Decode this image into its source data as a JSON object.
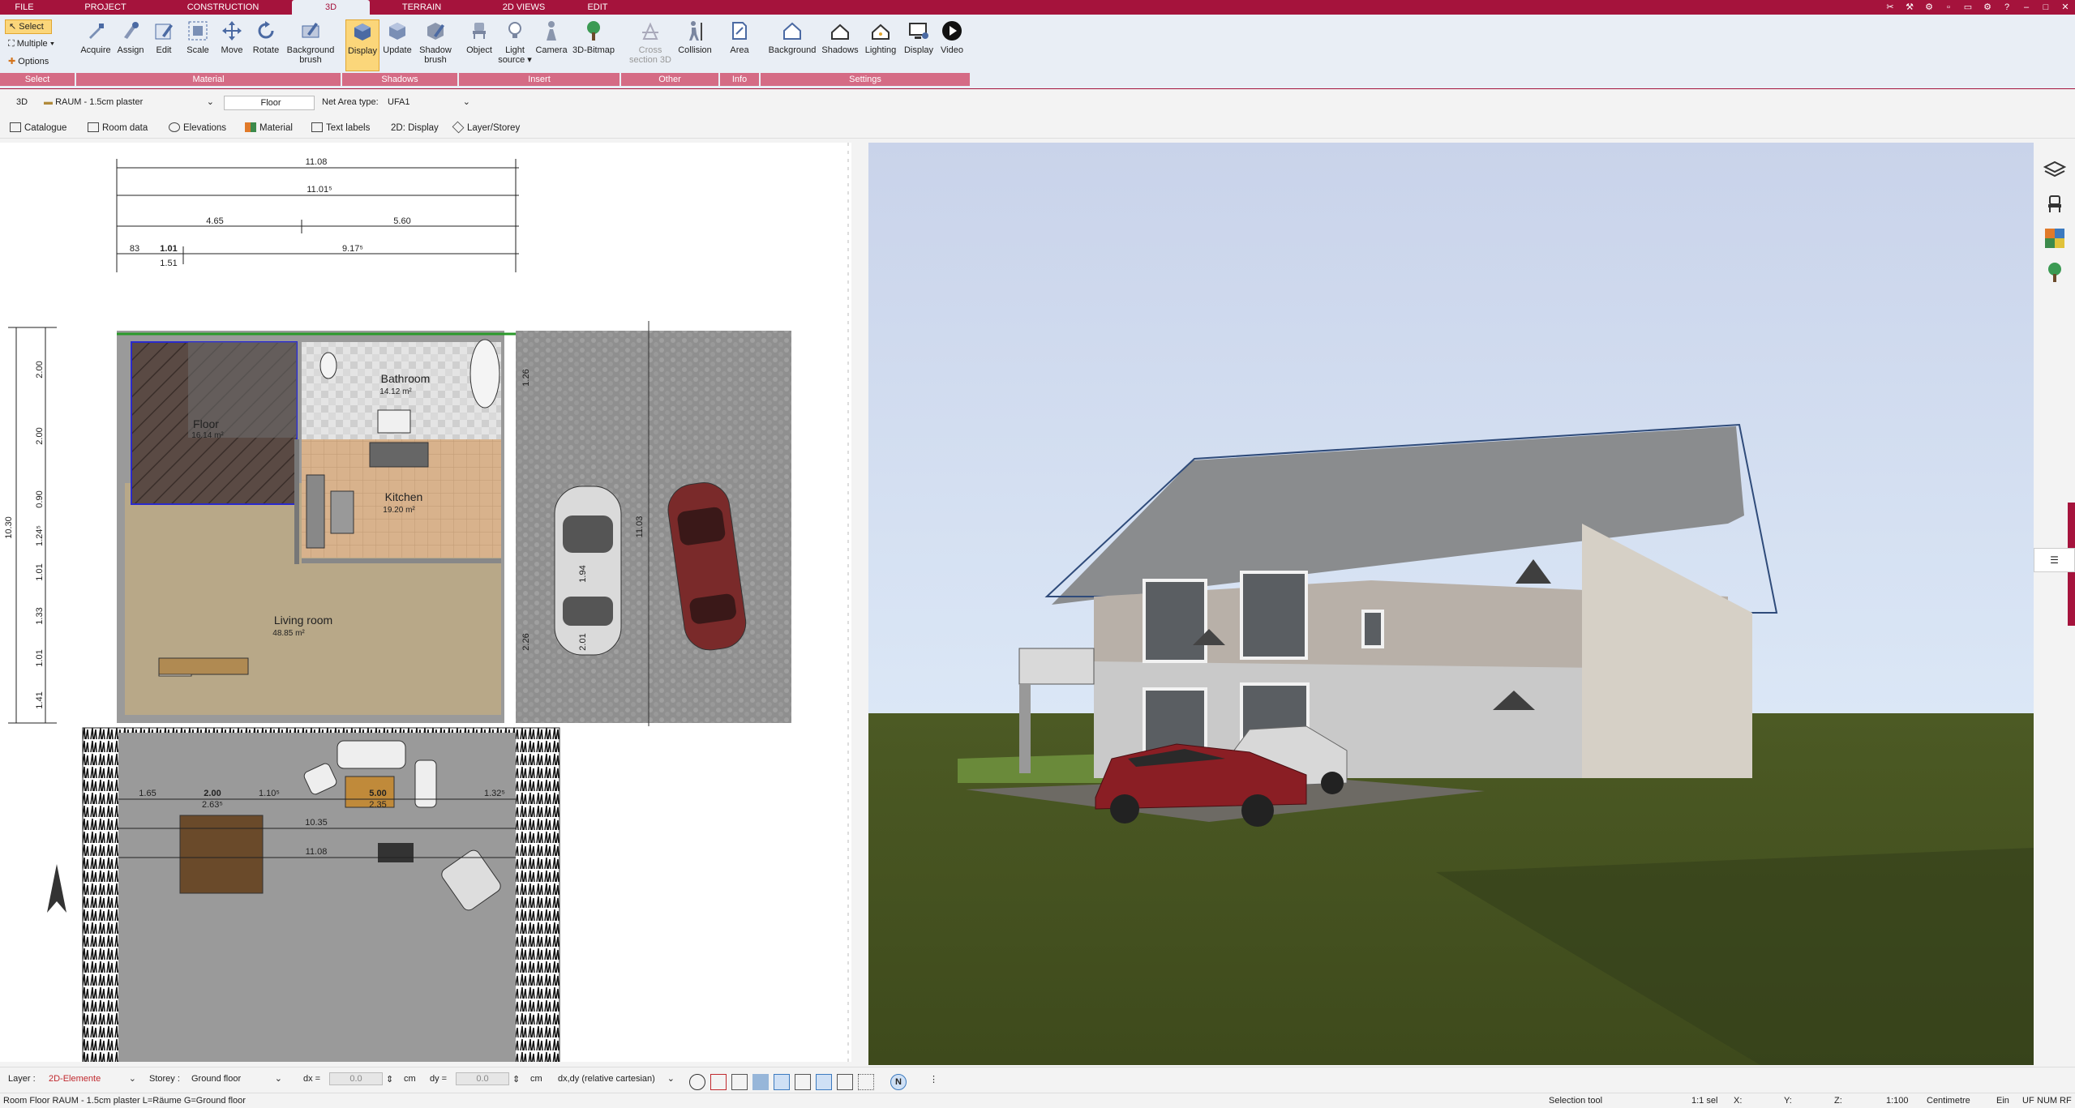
{
  "tabs": [
    {
      "label": "FILE"
    },
    {
      "label": "PROJECT"
    },
    {
      "label": "CONSTRUCTION"
    },
    {
      "label": "3D"
    },
    {
      "label": "TERRAIN"
    },
    {
      "label": "2D VIEWS"
    },
    {
      "label": "EDIT"
    }
  ],
  "ribbon": {
    "select": {
      "select": "Select",
      "multiple": "Multiple",
      "options": "Options"
    },
    "buttons": {
      "acquire": "Acquire",
      "assign": "Assign",
      "edit": "Edit",
      "scale": "Scale",
      "move": "Move",
      "rotate": "Rotate",
      "background_brush_1": "Background",
      "background_brush_2": "brush",
      "display": "Display",
      "update": "Update",
      "shadow_brush_1": "Shadow",
      "shadow_brush_2": "brush",
      "object": "Object",
      "light_source_1": "Light",
      "light_source_2": "source",
      "camera": "Camera",
      "bitmap3d": "3D-Bitmap",
      "cross_section_1": "Cross",
      "cross_section_2": "section 3D",
      "collision": "Collision",
      "area": "Area",
      "background": "Background",
      "shadows": "Shadows",
      "lighting": "Lighting",
      "display2": "Display",
      "video": "Video"
    },
    "groups": {
      "select": "Select",
      "material": "Material",
      "shadows": "Shadows",
      "insert": "Insert",
      "other": "Other",
      "info": "Info",
      "settings": "Settings"
    }
  },
  "propbar": {
    "mode": "3D",
    "room_combo": "RAUM - 1.5cm plaster",
    "floor_field": "Floor",
    "net_area_label": "Net Area type:",
    "net_area_value": "UFA1"
  },
  "toolbar2": {
    "catalogue": "Catalogue",
    "room_data": "Room data",
    "elevations": "Elevations",
    "material": "Material",
    "text_labels": "Text labels",
    "display_2d": "2D: Display",
    "layer_storey": "Layer/Storey"
  },
  "plan": {
    "rooms": [
      {
        "name": "Bathroom",
        "area": "14.12 m²"
      },
      {
        "name": "Floor",
        "area": "16.14 m²"
      },
      {
        "name": "Kitchen",
        "area": "19.20 m²"
      },
      {
        "name": "Living room",
        "area": "48.85 m²"
      }
    ],
    "dims": {
      "top1": "11.08",
      "top2": "11.01⁵",
      "seg1": "4.65",
      "seg2": "5.60",
      "seg3": "9.17⁵",
      "small1": "1.01",
      "small2": "1.51",
      "small3": "83",
      "left_total": "10.30",
      "left1": "2.00",
      "left2": "2.00",
      "left3": "0.90",
      "left4": "1.24⁵",
      "left5": "1.01",
      "left6": "1.33",
      "left7": "1.01",
      "left8": "1.41",
      "terr1": "1.65",
      "terr2": "2.00",
      "terr3": "2.63⁵",
      "terr4": "1.10⁵",
      "terr5": "5.00",
      "terr6": "2.35",
      "terr7": "1.32⁵",
      "terr8": "10.35",
      "terr9": "11.08",
      "garage1": "11.03",
      "garage2": "1.94",
      "garage3": "2.01",
      "garage4": "2.26",
      "garage5": "1.26"
    }
  },
  "status": {
    "layer_label": "Layer :",
    "layer_value": "2D-Elemente",
    "storey_label": "Storey :",
    "storey_value": "Ground floor",
    "dx_label": "dx =",
    "dx_value": "0.0",
    "dx_unit": "cm",
    "dy_label": "dy =",
    "dy_value": "0.0",
    "dy_unit": "cm",
    "coord_mode": "dx,dy (relative cartesian)"
  },
  "bottom": {
    "info": "Room Floor RAUM - 1.5cm plaster L=Räume G=Ground floor",
    "tool": "Selection tool",
    "sel": "1:1 sel",
    "x": "X:",
    "y": "Y:",
    "z": "Z:",
    "scale": "1:100",
    "unit": "Centimetre",
    "ein": "Ein",
    "uf": "UF",
    "num": "NUM",
    "rf": "RF"
  },
  "colors": {
    "brand": "#a5133c",
    "ribbon": "#e9eef5",
    "group_label": "#d56b85",
    "active": "#fbd67a"
  }
}
